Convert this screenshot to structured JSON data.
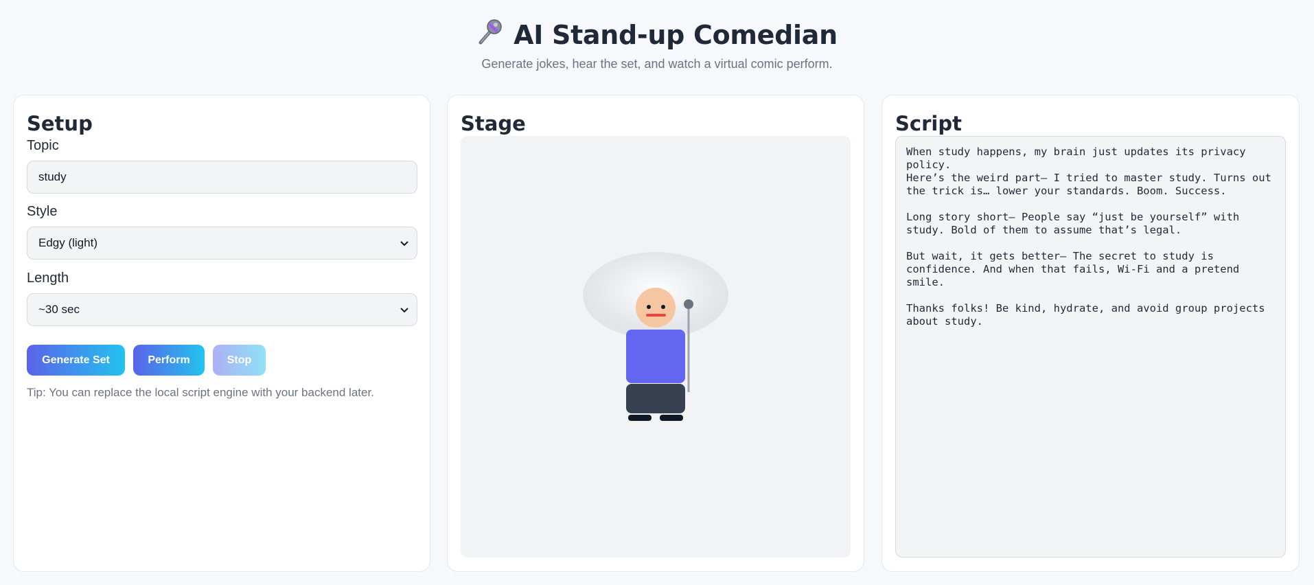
{
  "header": {
    "icon": "microphone-icon",
    "title": "AI Stand-up Comedian",
    "subtitle": "Generate jokes, hear the set, and watch a virtual comic perform."
  },
  "setup": {
    "title": "Setup",
    "topic_label": "Topic",
    "topic_value": "study",
    "style_label": "Style",
    "style_value": "Edgy (light)",
    "length_label": "Length",
    "length_value": "~30 sec",
    "generate_label": "Generate Set",
    "perform_label": "Perform",
    "stop_label": "Stop",
    "tip": "Tip: You can replace the local script engine with your backend later."
  },
  "stage": {
    "title": "Stage"
  },
  "script": {
    "title": "Script",
    "lines": [
      "When study happens, my brain just updates its privacy",
      "policy.",
      "Here’s the weird part— I tried to master study. Turns out",
      "the trick is… lower your standards. Boom. Success.",
      "",
      "Long story short— People say “just be yourself” with",
      "study. Bold of them to assume that’s legal.",
      "",
      "But wait, it gets better— The secret to study is",
      "confidence. And when that fails, Wi-Fi and a pretend",
      "smile.",
      "",
      "Thanks folks! Be kind, hydrate, and avoid group projects",
      "about study."
    ]
  },
  "colors": {
    "accent_start": "#5b63ea",
    "accent_end": "#22c3ee",
    "comic_shirt": "#6366f1",
    "comic_pants": "#374151",
    "comic_skin": "#f5c6a0",
    "mouth": "#ef4444"
  }
}
